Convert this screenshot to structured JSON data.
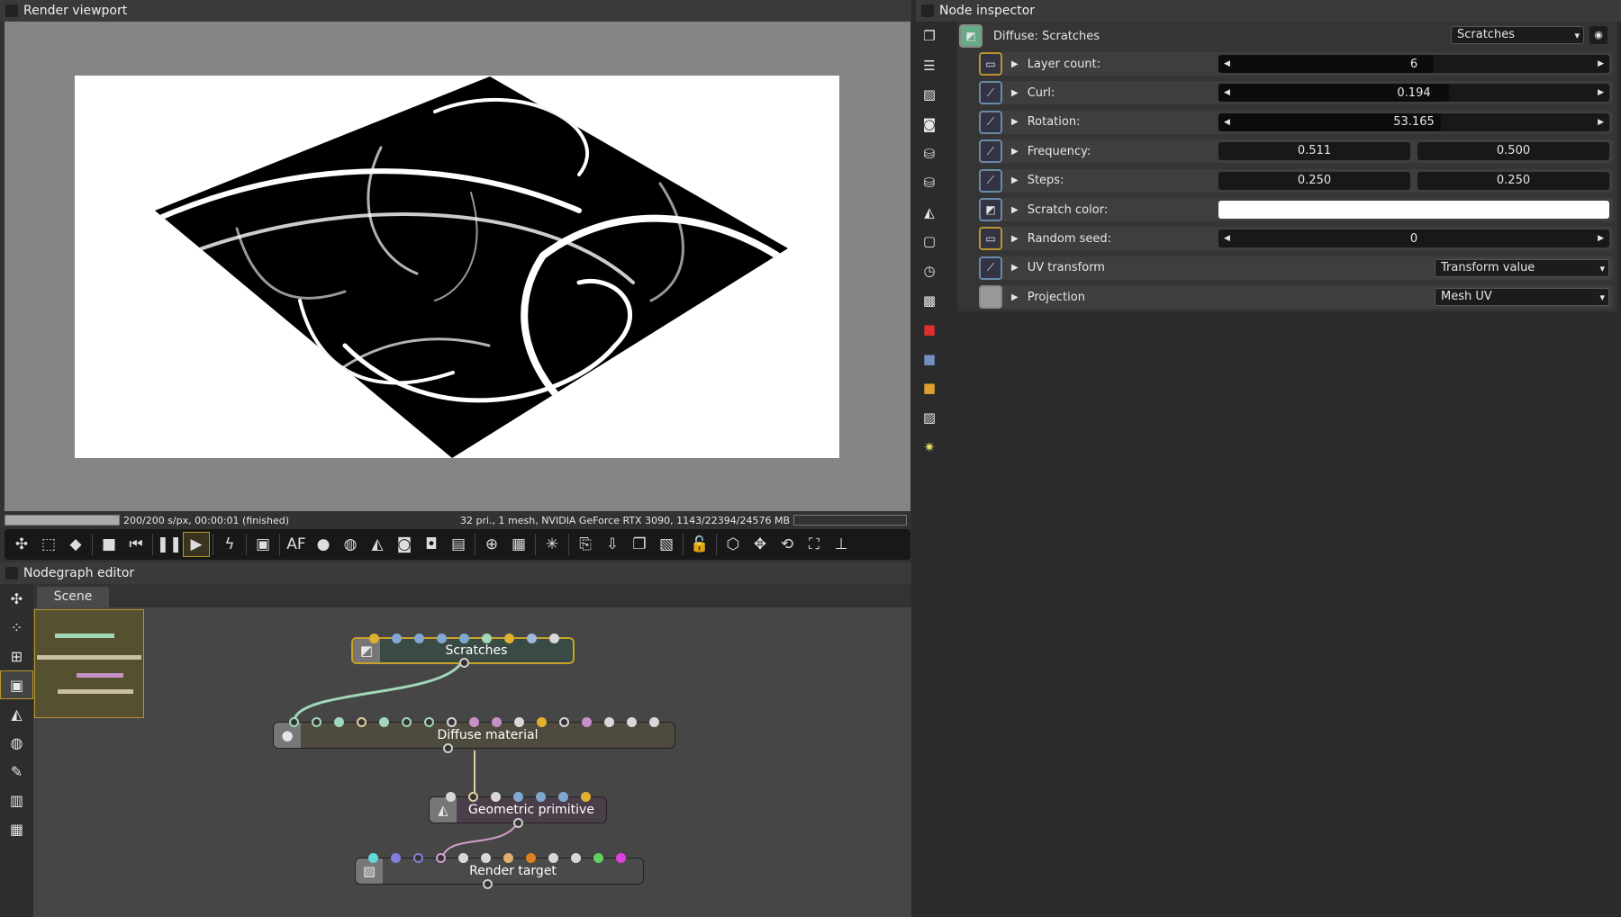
{
  "viewport": {
    "title": "Render viewport",
    "status_left": "200/200 s/px, 00:00:01 (finished)",
    "status_right": "32 pri., 1 mesh, NVIDIA GeForce RTX 3090, 1143/22394/24576 MB",
    "progress": 1.0
  },
  "toolbar": {
    "icons": [
      [
        "recenter-icon",
        "✣"
      ],
      [
        "region-icon",
        "⬚"
      ],
      [
        "color-cube-icon",
        "◆"
      ],
      "|",
      [
        "stop-icon",
        "■"
      ],
      [
        "rewind-icon",
        "⏮"
      ],
      "|",
      [
        "pause-icon",
        "❚❚"
      ],
      [
        "play-icon",
        "▶"
      ],
      "|",
      [
        "flash-icon",
        "ϟ"
      ],
      "|",
      [
        "display-icon",
        "▣"
      ],
      "|",
      [
        "af-icon",
        "AF"
      ],
      [
        "color-wheel-icon",
        "●"
      ],
      [
        "sphere-icon",
        "◍"
      ],
      [
        "material-icon",
        "◭"
      ],
      [
        "camera-pick-icon",
        "◙"
      ],
      [
        "render-region-icon",
        "◘"
      ],
      [
        "film-icon",
        "▤"
      ],
      "|",
      [
        "zoom-icon",
        "⊕"
      ],
      [
        "checker-icon",
        "▦"
      ],
      "|",
      [
        "spinner-icon",
        "✳"
      ],
      "|",
      [
        "clipboard-icon",
        "⎘"
      ],
      [
        "export-icon",
        "⇩"
      ],
      [
        "layers-icon",
        "❐"
      ],
      [
        "bake-icon",
        "▧"
      ],
      "|",
      [
        "lock-icon",
        "🔓"
      ],
      "|",
      [
        "cube-icon",
        "⬡"
      ],
      [
        "move-icon",
        "✥"
      ],
      [
        "rotate-icon",
        "⟲"
      ],
      [
        "fullscreen-icon",
        "⛶"
      ],
      [
        "axis-icon",
        "⊥"
      ]
    ],
    "active": "play-icon"
  },
  "nodegraph": {
    "title": "Nodegraph editor",
    "tab": "Scene",
    "left_icons": [
      [
        "recenter-icon",
        "✣"
      ],
      [
        "arrange-icon",
        "⁘"
      ],
      [
        "group-icon",
        "⊞"
      ],
      [
        "minimap-icon",
        "▣"
      ],
      [
        "geometry-icon",
        "◭"
      ],
      [
        "camera-icon",
        "◍"
      ],
      [
        "settings-icon",
        "✎"
      ],
      [
        "grid-magnet-icon",
        "▥"
      ],
      [
        "grid-icon",
        "▦"
      ]
    ],
    "nodes": [
      {
        "id": "scratches",
        "label": "Scratches",
        "icon": "texture-icon",
        "glyph": "◩",
        "bg": "#3a4a44",
        "border": "#c9a227",
        "ports": [
          "#e0b030",
          "#80a8d0",
          "#80a8d0",
          "#80a8d0",
          "#80a8d0",
          "#a0d8b8",
          "#e0b030",
          "#a0b8d8",
          "#d8d8d8"
        ]
      },
      {
        "id": "diffuse",
        "label": "Diffuse material",
        "icon": "material-ball-icon",
        "glyph": "●",
        "bg": "#4e4a3e",
        "border": "#222",
        "ports": [
          "o#a0d8b8",
          "o#a0d8b8",
          "#a0d8b8",
          "o#e0d0a0",
          "#a0d8b8",
          "o#a0d8b8",
          "o#a0d8b8",
          "o#d8d8d8",
          "#c890c8",
          "#c890c8",
          "#d8d8d8",
          "#e0b030",
          "o#d8d8d8",
          "#c890c8",
          "#d8d8d8",
          "#d8d8d8",
          "#d8d8d8"
        ]
      },
      {
        "id": "geometric",
        "label": "Geometric primitive",
        "icon": "geometry-icon",
        "glyph": "◭",
        "bg": "#4a3e4a",
        "border": "#222",
        "ports": [
          "#d8d8d8",
          "o#e0d0a0",
          "#d8d8d8",
          "#80a8d0",
          "#80a8d0",
          "#80a8d0",
          "#e0b030"
        ]
      },
      {
        "id": "render_target",
        "label": "Render target",
        "icon": "image-icon",
        "glyph": "▨",
        "bg": "#4a4a4a",
        "border": "#222",
        "ports": [
          "#60d8d8",
          "#8080e0",
          "o#8080e0",
          "o#d0a0d0",
          "#d8d8d8",
          "#d8d8d8",
          "#e0b070",
          "#e08020",
          "#d8d8d8",
          "#d8d8d8",
          "#60d060",
          "#e040e0"
        ]
      }
    ]
  },
  "inspector": {
    "title": "Node inspector",
    "header": "Diffuse: Scratches",
    "selector": "Scratches",
    "left_icons": [
      [
        "copy-icon",
        "❐"
      ],
      [
        "stack-icon",
        "☰"
      ],
      [
        "image-icon",
        "▨"
      ],
      [
        "camera-icon",
        "◙"
      ],
      [
        "database-icon",
        "⛁"
      ],
      [
        "database-sync-icon",
        "⛁"
      ],
      [
        "geometry-icon",
        "◭"
      ],
      [
        "frame-icon",
        "▢"
      ],
      [
        "clock-icon",
        "◷"
      ],
      [
        "texture-icon",
        "▩"
      ],
      [
        "red-cube-icon",
        "■"
      ],
      [
        "blue-cube-icon",
        "■"
      ],
      [
        "orange-cube-icon",
        "■"
      ],
      [
        "picture-icon",
        "▨"
      ],
      [
        "sun-icon",
        "✷"
      ]
    ],
    "rows": [
      {
        "label": "Layer count:",
        "type": "slider",
        "value": "6",
        "fill": 0.55,
        "icon": "y"
      },
      {
        "label": "Curl:",
        "type": "slider",
        "value": "0.194",
        "fill": 0.59,
        "icon": "b"
      },
      {
        "label": "Rotation:",
        "type": "slider",
        "value": "53.165",
        "fill": 0.57,
        "icon": "b"
      },
      {
        "label": "Frequency:",
        "type": "pair",
        "values": [
          "0.511",
          "0.500"
        ],
        "icon": "b"
      },
      {
        "label": "Steps:",
        "type": "pair",
        "values": [
          "0.250",
          "0.250"
        ],
        "icon": "b"
      },
      {
        "label": "Scratch color:",
        "type": "color",
        "color": "#ffffff",
        "icon": "c"
      },
      {
        "label": "Random seed:",
        "type": "slider",
        "value": "0",
        "fill": 0,
        "icon": "y"
      },
      {
        "label": "UV transform",
        "type": "dropdown",
        "value": "Transform value",
        "icon": "b"
      },
      {
        "label": "Projection",
        "type": "dropdown",
        "value": "Mesh UV",
        "icon": "g"
      }
    ]
  }
}
